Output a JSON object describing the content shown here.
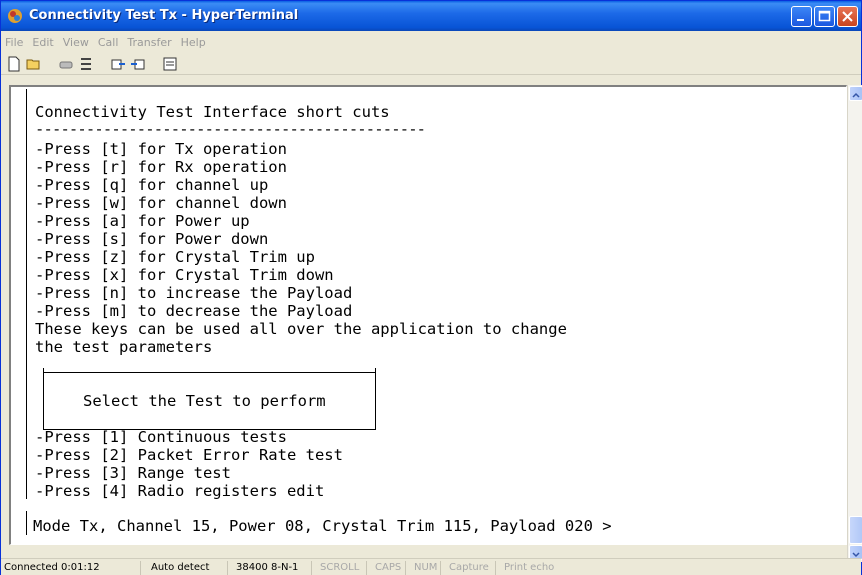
{
  "window": {
    "title": "Connectivity Test Tx - HyperTerminal"
  },
  "menubar": {
    "items": [
      "File",
      "Edit",
      "View",
      "Call",
      "Transfer",
      "Help"
    ]
  },
  "toolbar": {
    "icons": [
      "new-icon",
      "open-icon",
      "disconnect-icon",
      "call-icon",
      "send-icon",
      "receive-icon",
      "properties-icon"
    ]
  },
  "terminal": {
    "lines": [
      "Connectivity Test Interface short cuts",
      "----------------------------------------------",
      "-Press [t] for Tx operation",
      "-Press [r] for Rx operation",
      "-Press [q] for channel up",
      "-Press [w] for channel down",
      "-Press [a] for Power up",
      "-Press [s] for Power down",
      "-Press [z] for Crystal Trim up",
      "-Press [x] for Crystal Trim down",
      "-Press [n] to increase the Payload",
      "-Press [m] to decrease the Payload",
      "These keys can be used all over the application to change",
      "the test parameters",
      "Select the Test to perform",
      "-Press [1] Continuous tests",
      "-Press [2] Packet Error Rate test",
      "-Press [3] Range test",
      "-Press [4] Radio registers edit",
      "Mode Tx, Channel 15, Power 08, Crystal Trim 115, Payload 020 >"
    ]
  },
  "statusbar": {
    "connected": "Connected 0:01:12",
    "detect": "Auto detect",
    "port": "38400 8-N-1",
    "scroll": "SCROLL",
    "caps": "CAPS",
    "num": "NUM",
    "capture": "Capture",
    "echo": "Print echo"
  }
}
